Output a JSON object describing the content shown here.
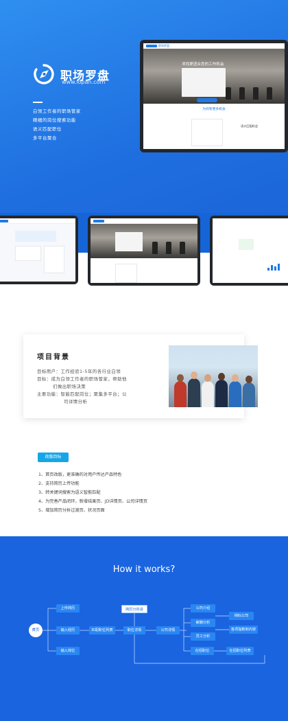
{
  "brand": {
    "name": "职场罗盘",
    "url": "www.lopan.com",
    "features": [
      "白领工作者的职场管家",
      "精细的岗位搜索功能",
      "语义匹配职位",
      "多平台聚合"
    ],
    "colors": {
      "primary": "#1a64e0",
      "accent": "#16a6e8"
    }
  },
  "mockups": {
    "main_headline": "寻找更适合您的工作机会",
    "search_button": "搜索",
    "section_title": "为何有更多机会",
    "card_title": "语义匹配机会",
    "logo_text": "职场罗盘"
  },
  "background": {
    "title": "项目背景",
    "lines": [
      "目标用户：工作经验1-5年的各行业白领",
      "目标：成为白领工作者的职场管家，帮助他",
      "们做出职场决策",
      "主要功能：智能匹配岗位；聚集多平台；公",
      "司详情分析"
    ]
  },
  "goals": {
    "badge": "改版目标",
    "items": [
      "1、首页改版，更准确的对用户传达产品特色",
      "2、支持简历上传功能",
      "3、转关键词搜索为语义智能匹配",
      "4、为完善产品闭环，新增结果页、JD详情页、公司详情页",
      "5、增加简历分析过渡页、状况页面"
    ]
  },
  "how": {
    "title": "How it works?",
    "home": "首页",
    "upload": "上传简历",
    "input_resume": "输入经历",
    "input_job": "输入岗位",
    "match_list": "匹配职位列表",
    "job_detail": "职位详情",
    "company_detail": "公司详情",
    "resume_analysis": "简历分析进",
    "company_intro": "公司介绍",
    "salary": "薪酬分析",
    "staff": "员工分析",
    "current_jobs": "在招职位",
    "similar": "相似公司",
    "industry": "各项指数和内容",
    "current_list": "在招职位列表"
  }
}
